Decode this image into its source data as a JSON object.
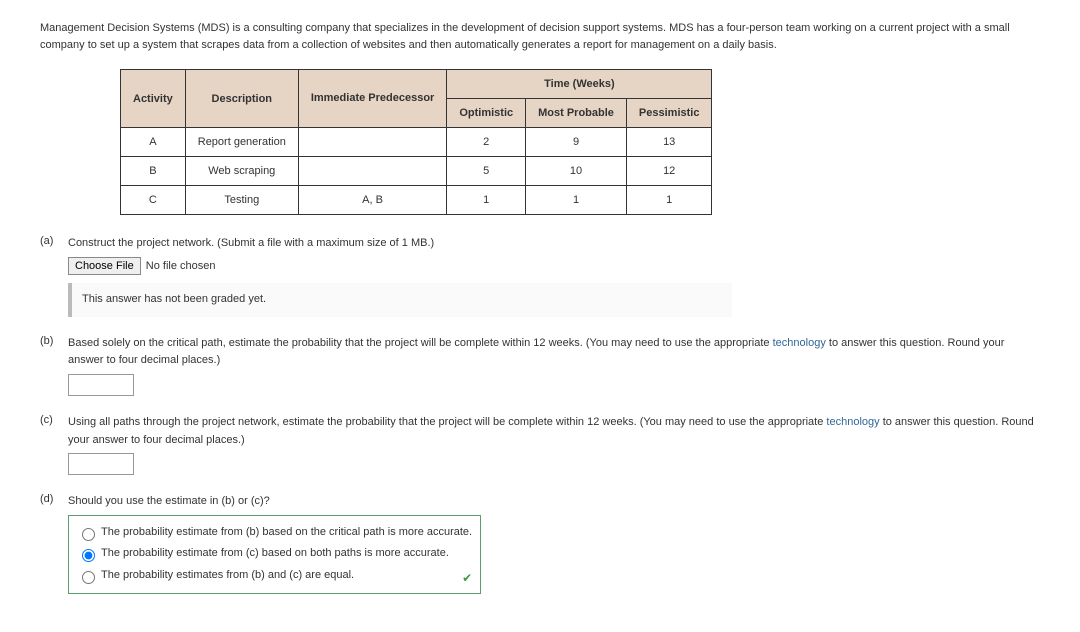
{
  "intro": "Management Decision Systems (MDS) is a consulting company that specializes in the development of decision support systems. MDS has a four-person team working on a current project with a small company to set up a system that scrapes data from a collection of websites and then automatically generates a report for management on a daily basis.",
  "table": {
    "time_header": "Time (Weeks)",
    "headers": {
      "activity": "Activity",
      "description": "Description",
      "predecessor": "Immediate Predecessor",
      "optimistic": "Optimistic",
      "most_probable": "Most Probable",
      "pessimistic": "Pessimistic"
    },
    "rows": [
      {
        "activity": "A",
        "description": "Report generation",
        "predecessor": "",
        "optimistic": "2",
        "most_probable": "9",
        "pessimistic": "13"
      },
      {
        "activity": "B",
        "description": "Web scraping",
        "predecessor": "",
        "optimistic": "5",
        "most_probable": "10",
        "pessimistic": "12"
      },
      {
        "activity": "C",
        "description": "Testing",
        "predecessor": "A, B",
        "optimistic": "1",
        "most_probable": "1",
        "pessimistic": "1"
      }
    ]
  },
  "parts": {
    "a": {
      "label": "(a)",
      "text": "Construct the project network. (Submit a file with a maximum size of 1 MB.)",
      "choose_file": "Choose File",
      "no_file": "No file chosen",
      "note": "This answer has not been graded yet."
    },
    "b": {
      "label": "(b)",
      "text_before": "Based solely on the critical path, estimate the probability that the project will be complete within 12 weeks. (You may need to use the appropriate ",
      "link": "technology",
      "text_after": " to answer this question. Round your answer to four decimal places.)"
    },
    "c": {
      "label": "(c)",
      "text_before": "Using all paths through the project network, estimate the probability that the project will be complete within 12 weeks. (You may need to use the appropriate ",
      "link": "technology",
      "text_after": " to answer this question. Round your answer to four decimal places.)"
    },
    "d": {
      "label": "(d)",
      "text": "Should you use the estimate in (b) or (c)?",
      "options": [
        "The probability estimate from (b) based on the critical path is more accurate.",
        "The probability estimate from (c) based on both paths is more accurate.",
        "The probability estimates from (b) and (c) are equal."
      ],
      "selected": 1
    }
  }
}
